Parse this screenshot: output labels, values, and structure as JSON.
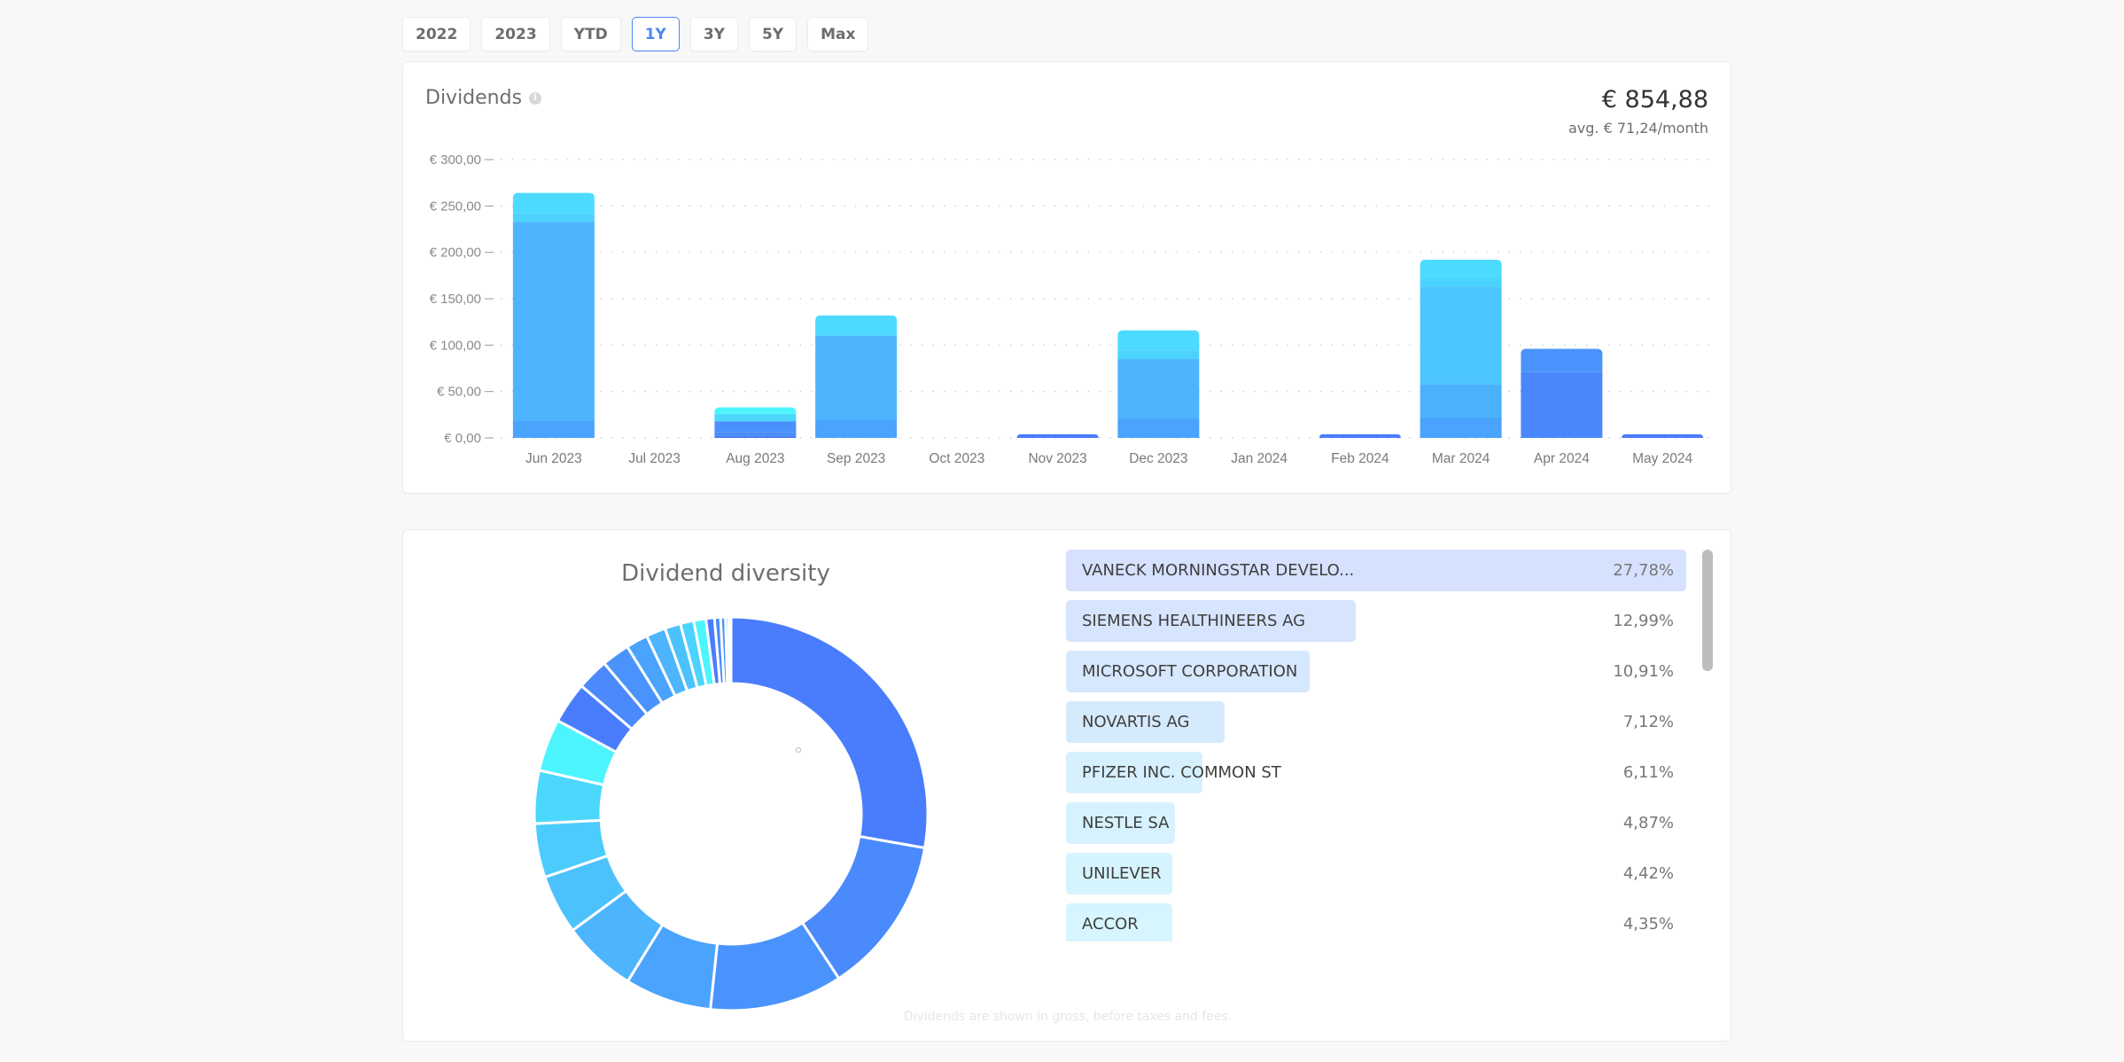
{
  "range_buttons": [
    {
      "label": "2022",
      "active": false
    },
    {
      "label": "2023",
      "active": false
    },
    {
      "label": "YTD",
      "active": false
    },
    {
      "label": "1Y",
      "active": true
    },
    {
      "label": "3Y",
      "active": false
    },
    {
      "label": "5Y",
      "active": false
    },
    {
      "label": "Max",
      "active": false
    }
  ],
  "dividends_card": {
    "title": "Dividends",
    "info_icon": "info-icon",
    "total": "€ 854,88",
    "average": "avg. € 71,24/month"
  },
  "chart_data": [
    {
      "type": "bar",
      "stacked": true,
      "title": "Dividends",
      "xlabel": "",
      "ylabel": "",
      "ylim": [
        0,
        300
      ],
      "yticks": [
        0,
        50,
        100,
        150,
        200,
        250,
        300
      ],
      "ytick_labels": [
        "€ 0,00",
        "€ 50,00",
        "€ 100,00",
        "€ 150,00",
        "€ 200,00",
        "€ 250,00",
        "€ 300,00"
      ],
      "grid": true,
      "categories": [
        "Jun 2023",
        "Jul 2023",
        "Aug 2023",
        "Sep 2023",
        "Oct 2023",
        "Nov 2023",
        "Dec 2023",
        "Jan 2024",
        "Feb 2024",
        "Mar 2024",
        "Apr 2024",
        "May 2024"
      ],
      "stacks": [
        [
          {
            "value": 19,
            "color": "#4aa3fd"
          },
          {
            "value": 214,
            "color": "#4cb5fd"
          },
          {
            "value": 9,
            "color": "#4cd3fd"
          },
          {
            "value": 22,
            "color": "#4cdbfe"
          }
        ],
        [],
        [
          {
            "value": 2,
            "color": "#4a7dfd"
          },
          {
            "value": 4,
            "color": "#4a8cfb"
          },
          {
            "value": 12,
            "color": "#4a90fd"
          },
          {
            "value": 8,
            "color": "#4cd8fd"
          },
          {
            "value": 7,
            "color": "#4cf5fe"
          }
        ],
        [
          {
            "value": 20,
            "color": "#4aa3fd"
          },
          {
            "value": 90,
            "color": "#4cb5fd"
          },
          {
            "value": 22,
            "color": "#4cdbfe"
          }
        ],
        [],
        [
          {
            "value": 4,
            "color": "#4a7dfd"
          }
        ],
        [
          {
            "value": 21,
            "color": "#4aa3fd"
          },
          {
            "value": 64,
            "color": "#4cb5fd"
          },
          {
            "value": 9,
            "color": "#4cd3fd"
          },
          {
            "value": 22,
            "color": "#4cdbfe"
          }
        ],
        [],
        [
          {
            "value": 4,
            "color": "#4a7dfd"
          }
        ],
        [
          {
            "value": 22,
            "color": "#4aa3fd"
          },
          {
            "value": 36,
            "color": "#4ab2fd"
          },
          {
            "value": 105,
            "color": "#4cc4fd"
          },
          {
            "value": 9,
            "color": "#4cd3fd"
          },
          {
            "value": 20,
            "color": "#4cdbfe"
          }
        ],
        [
          {
            "value": 71,
            "color": "#4a87fd"
          },
          {
            "value": 25,
            "color": "#4a93fd"
          }
        ],
        [
          {
            "value": 4,
            "color": "#4a7dfd"
          }
        ]
      ]
    },
    {
      "type": "pie",
      "donut": true,
      "title": "Dividend diversity",
      "slices": [
        {
          "label": "VANECK MORNINGSTAR DEVELO...",
          "value": 27.78,
          "color": "#4a7dfd"
        },
        {
          "label": "SIEMENS HEALTHINEERS AG",
          "value": 12.99,
          "color": "#4a8afd"
        },
        {
          "label": "MICROSOFT CORPORATION",
          "value": 10.91,
          "color": "#4a93fd"
        },
        {
          "label": "NOVARTIS AG",
          "value": 7.12,
          "color": "#4aa3fd"
        },
        {
          "label": "PFIZER INC. COMMON ST",
          "value": 6.11,
          "color": "#4cb5fd"
        },
        {
          "label": "NESTLE SA",
          "value": 4.87,
          "color": "#4cc2fd"
        },
        {
          "label": "UNILEVER",
          "value": 4.42,
          "color": "#4cccfd"
        },
        {
          "label": "ACCOR",
          "value": 4.35,
          "color": "#4cd8fd"
        },
        {
          "label": "",
          "value": 4.3,
          "color": "#4cf5fe"
        },
        {
          "label": "",
          "value": 3.4,
          "color": "#4a7dfd"
        },
        {
          "label": "",
          "value": 2.6,
          "color": "#4a8afd"
        },
        {
          "label": "",
          "value": 2.3,
          "color": "#4a93fd"
        },
        {
          "label": "",
          "value": 1.8,
          "color": "#4aa3fd"
        },
        {
          "label": "",
          "value": 1.6,
          "color": "#4cb5fd"
        },
        {
          "label": "",
          "value": 1.3,
          "color": "#4cc2fd"
        },
        {
          "label": "",
          "value": 1.1,
          "color": "#4cd3fd"
        },
        {
          "label": "",
          "value": 1.0,
          "color": "#4cf5fe"
        },
        {
          "label": "",
          "value": 0.7,
          "color": "#4a7dfd"
        },
        {
          "label": "",
          "value": 0.5,
          "color": "#4a8afd"
        },
        {
          "label": "",
          "value": 0.4,
          "color": "#4a93fd"
        },
        {
          "label": "",
          "value": 0.25,
          "color": "#4aa3fd"
        },
        {
          "label": "",
          "value": 0.2,
          "color": "#4cb5fd"
        }
      ]
    }
  ],
  "diversity_card": {
    "title": "Dividend diversity",
    "list": [
      {
        "name": "VANECK MORNINGSTAR DEVELO...",
        "pct": "27,78%",
        "value": 27.78,
        "bg": "#d6e1fe"
      },
      {
        "name": "SIEMENS HEALTHINEERS AG",
        "pct": "12,99%",
        "value": 12.99,
        "bg": "#d6e4fe"
      },
      {
        "name": "MICROSOFT CORPORATION",
        "pct": "10,91%",
        "value": 10.91,
        "bg": "#d6e8fe"
      },
      {
        "name": "NOVARTIS AG",
        "pct": "7,12%",
        "value": 7.12,
        "bg": "#d6eafe"
      },
      {
        "name": "PFIZER INC. COMMON ST",
        "pct": "6,11%",
        "value": 6.11,
        "bg": "#d6f0fe"
      },
      {
        "name": "NESTLE SA",
        "pct": "4,87%",
        "value": 4.87,
        "bg": "#d6f2fe"
      },
      {
        "name": "UNILEVER",
        "pct": "4,42%",
        "value": 4.42,
        "bg": "#d6f4fe"
      },
      {
        "name": "ACCOR",
        "pct": "4,35%",
        "value": 4.35,
        "bg": "#d6f5fe"
      }
    ],
    "footnote": "Dividends are shown in gross, before taxes and fees."
  }
}
